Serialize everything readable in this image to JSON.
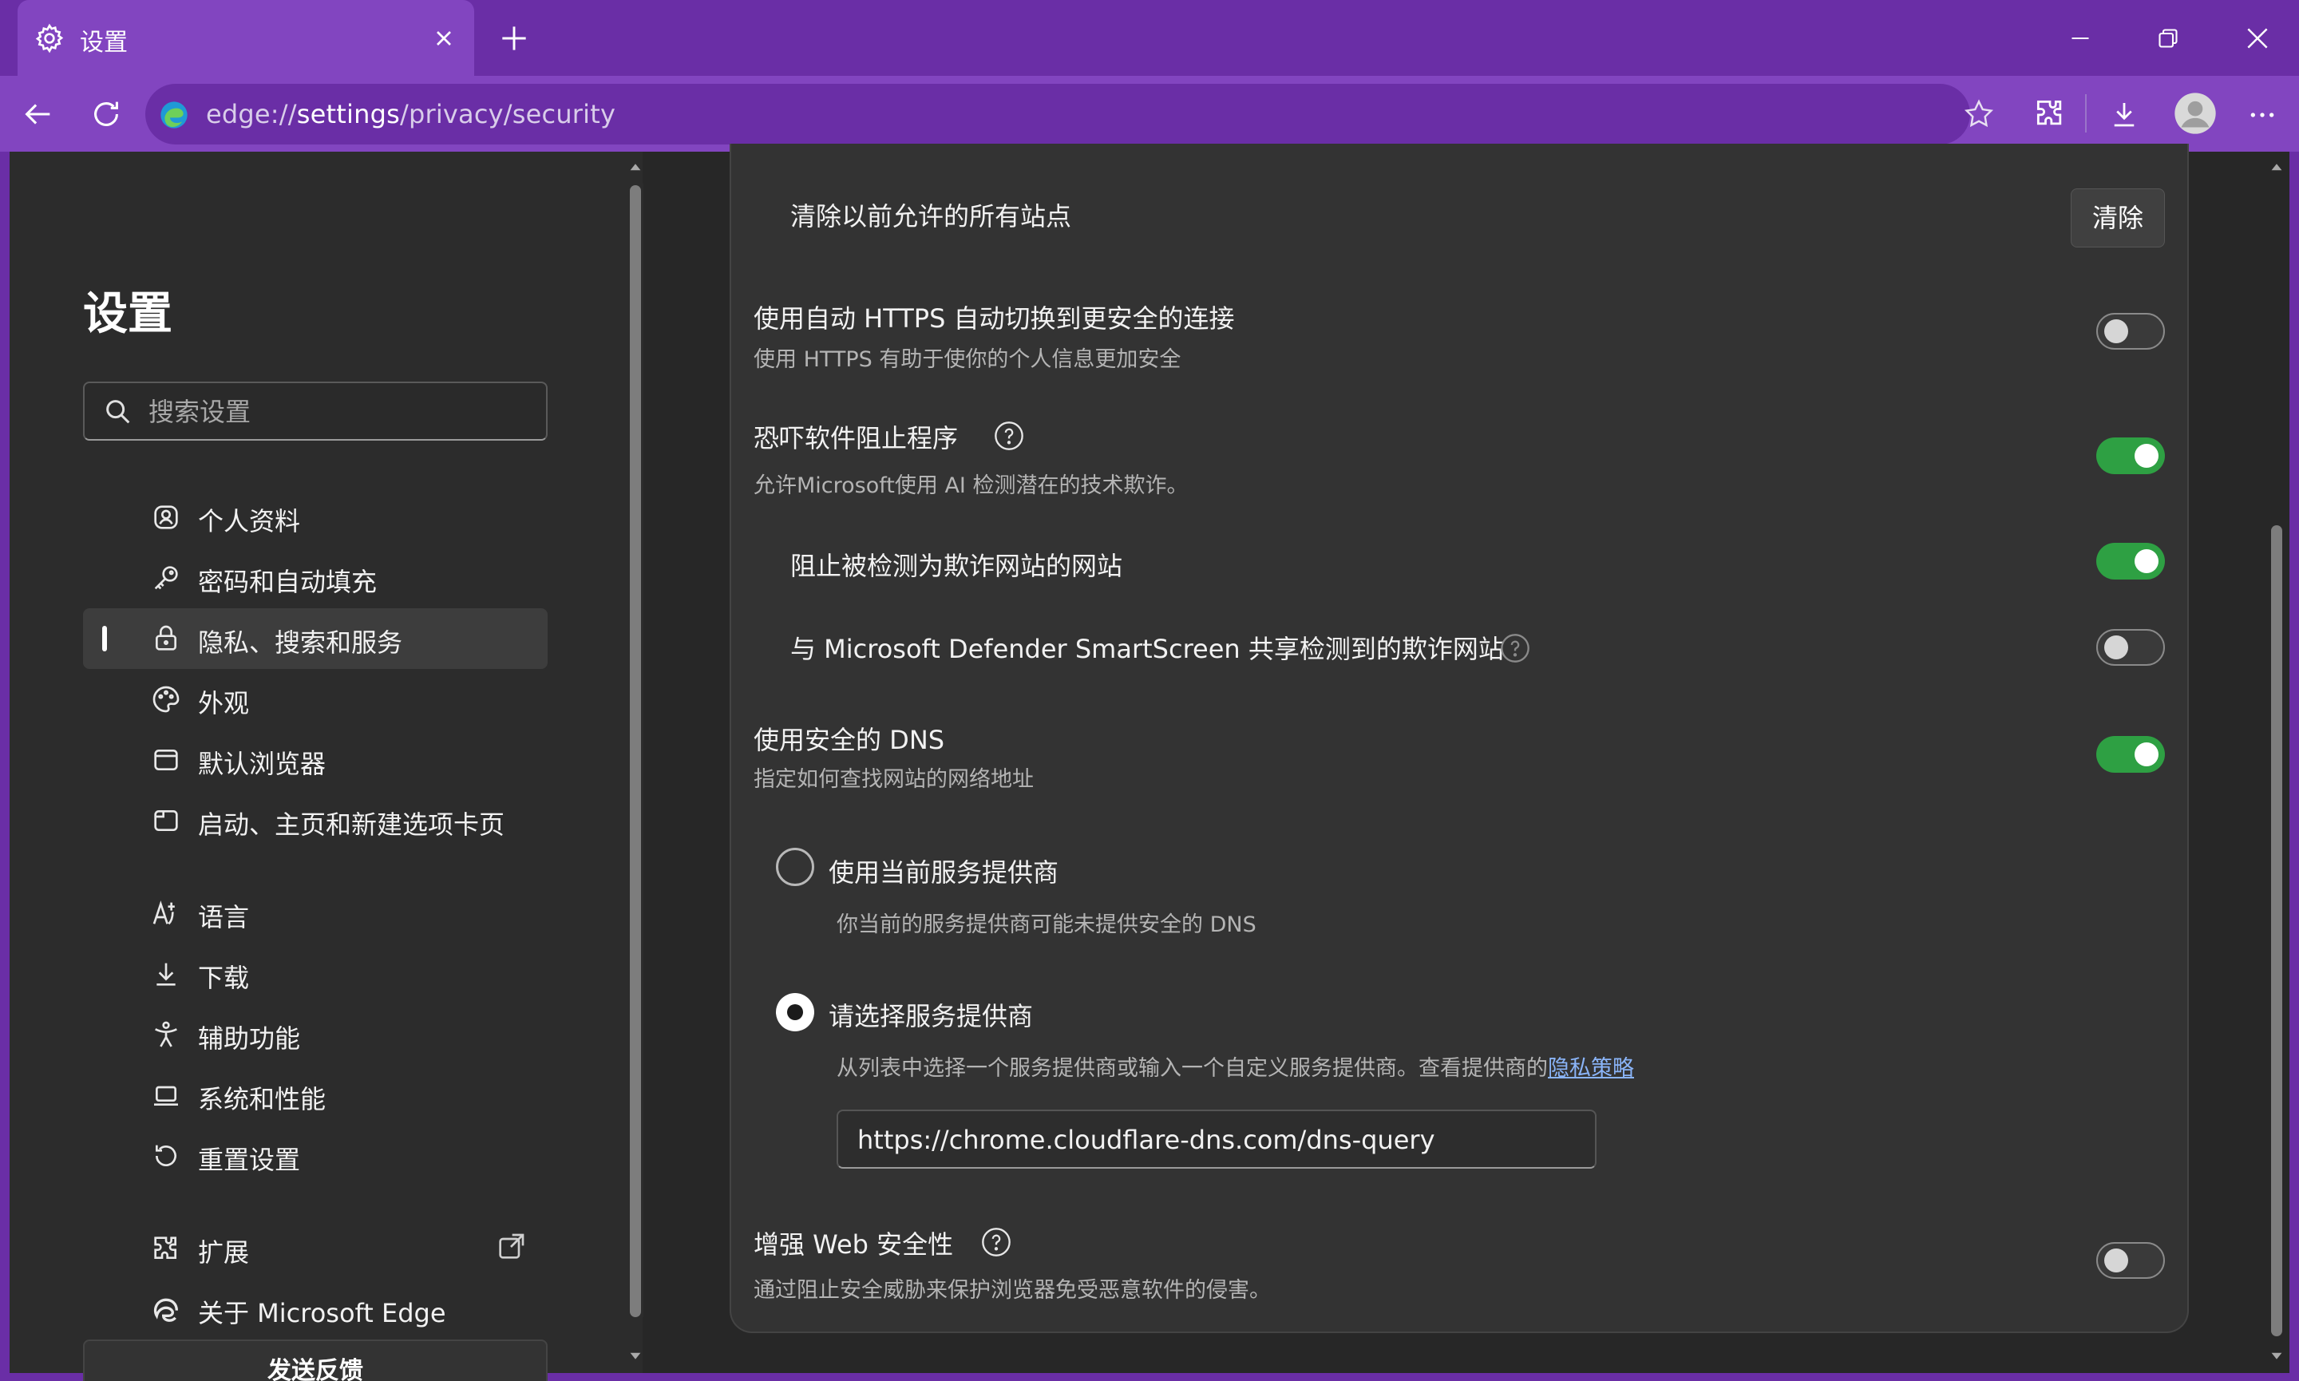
{
  "browser": {
    "tab_title": "设置",
    "url_scheme": "edge://",
    "url_host": "settings",
    "url_path": "/privacy/security"
  },
  "sidebar": {
    "title": "设置",
    "search_placeholder": "搜索设置",
    "items": [
      {
        "label": "个人资料",
        "icon": "profile-icon"
      },
      {
        "label": "密码和自动填充",
        "icon": "key-icon"
      },
      {
        "label": "隐私、搜索和服务",
        "icon": "lock-icon",
        "active": true
      },
      {
        "label": "外观",
        "icon": "palette-icon"
      },
      {
        "label": "默认浏览器",
        "icon": "browser-icon"
      },
      {
        "label": "启动、主页和新建选项卡页",
        "icon": "home-page-icon"
      },
      {
        "label": "语言",
        "icon": "language-icon"
      },
      {
        "label": "下载",
        "icon": "download-icon"
      },
      {
        "label": "辅助功能",
        "icon": "accessibility-icon"
      },
      {
        "label": "系统和性能",
        "icon": "laptop-icon"
      },
      {
        "label": "重置设置",
        "icon": "reset-icon"
      },
      {
        "label": "扩展",
        "icon": "extensions-icon"
      },
      {
        "label": "关于 Microsoft Edge",
        "icon": "edge-logo-icon"
      }
    ],
    "feedback_label": "发送反馈"
  },
  "main": {
    "clear_sites": {
      "label": "清除以前允许的所有站点",
      "button": "清除"
    },
    "auto_https": {
      "title": "使用自动 HTTPS 自动切换到更安全的连接",
      "desc": "使用 HTTPS 有助于使你的个人信息更加安全",
      "enabled": false
    },
    "scareware": {
      "title": "恐吓软件阻止程序",
      "desc": "允许Microsoft使用 AI 检测潜在的技术欺诈。",
      "enabled": true
    },
    "block_scam": {
      "title": "阻止被检测为欺诈网站的网站",
      "enabled": true
    },
    "share_smartscreen": {
      "title": "与 Microsoft Defender SmartScreen 共享检测到的欺诈网站",
      "enabled": false
    },
    "secure_dns": {
      "title": "使用安全的 DNS",
      "desc": "指定如何查找网站的网络地址",
      "enabled": true,
      "option_current": {
        "label": "使用当前服务提供商",
        "desc": "你当前的服务提供商可能未提供安全的 DNS",
        "selected": false
      },
      "option_choose": {
        "label": "请选择服务提供商",
        "desc": "从列表中选择一个服务提供商或输入一个自定义服务提供商。查看提供商的",
        "link": "隐私策略",
        "selected": true
      },
      "provider_value": "https://chrome.cloudflare-dns.com/dns-query"
    },
    "enhanced_security": {
      "title": "增强 Web 安全性",
      "desc": "通过阻止安全威胁来保护浏览器免受恶意软件的侵害。",
      "enabled": false
    }
  },
  "colors": {
    "accent_purple": "#8245c0",
    "toggle_on": "#2ea043",
    "link": "#8ab4f8"
  }
}
